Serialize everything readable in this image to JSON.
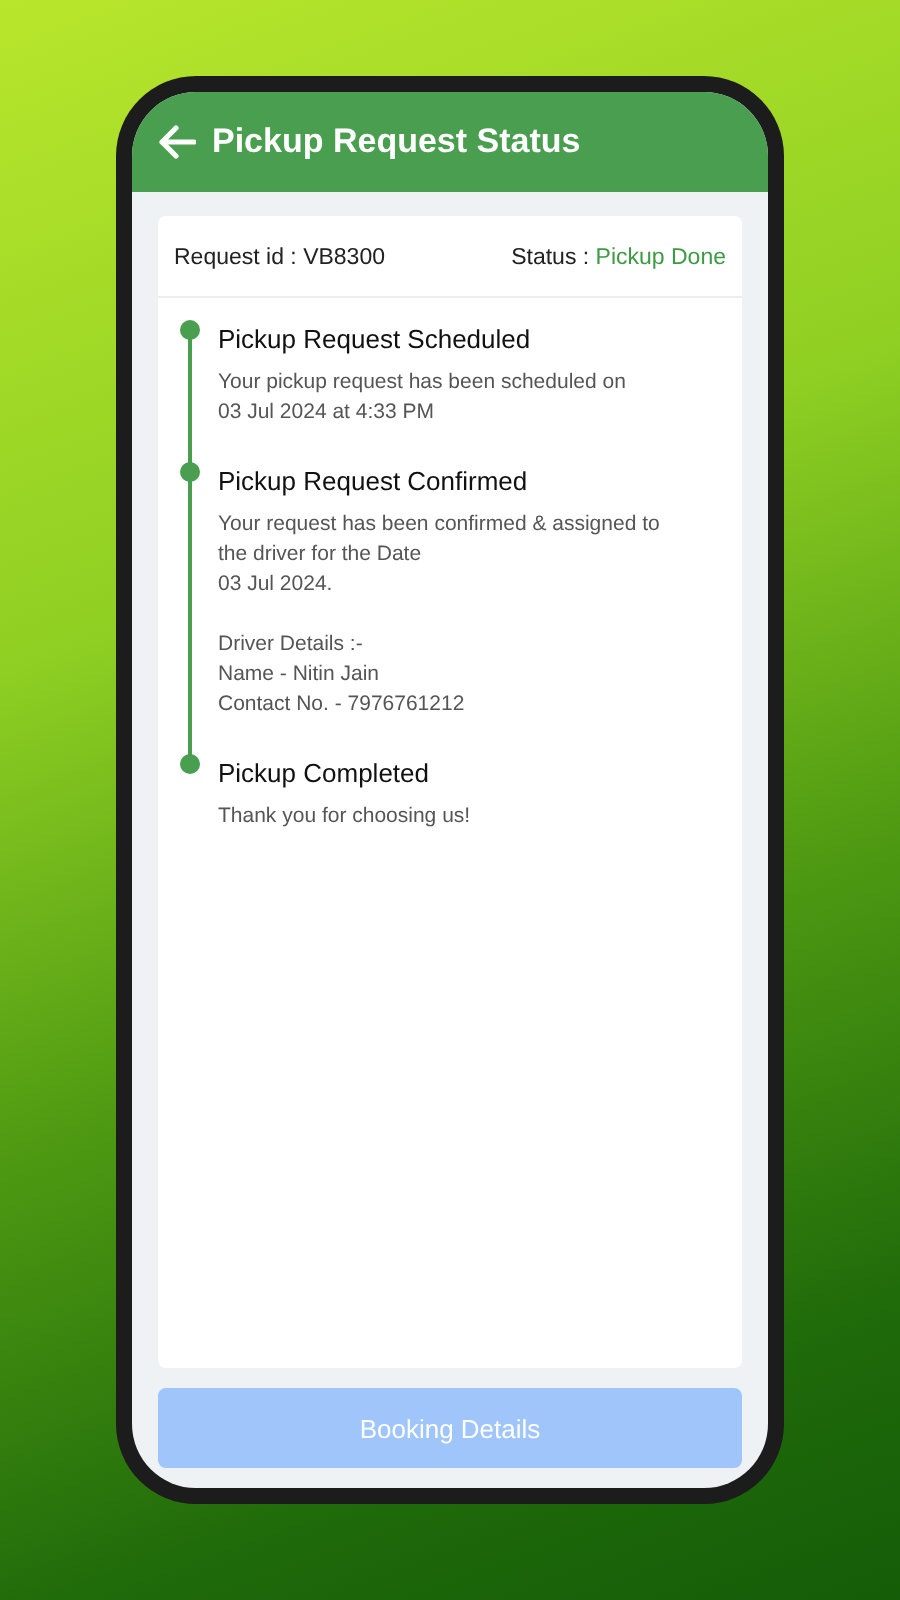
{
  "header": {
    "title": "Pickup Request Status"
  },
  "request": {
    "id_label": "Request id : VB8300",
    "status_label": "Status : ",
    "status_value": "Pickup Done"
  },
  "steps": [
    {
      "title": "Pickup Request Scheduled",
      "done": true,
      "paragraphs": [
        "Your pickup request has been scheduled on\n03 Jul 2024 at 4:33 PM"
      ]
    },
    {
      "title": "Pickup Request Confirmed",
      "done": true,
      "paragraphs": [
        "Your request has been confirmed & assigned to\nthe driver for the Date\n03 Jul 2024.",
        "Driver Details :-\nName - Nitin Jain\nContact No. - 7976761212"
      ]
    },
    {
      "title": "Pickup Completed",
      "done": true,
      "paragraphs": [
        "Thank you for choosing us!"
      ]
    }
  ],
  "button": {
    "label": "Booking Details",
    "disabled": true
  }
}
